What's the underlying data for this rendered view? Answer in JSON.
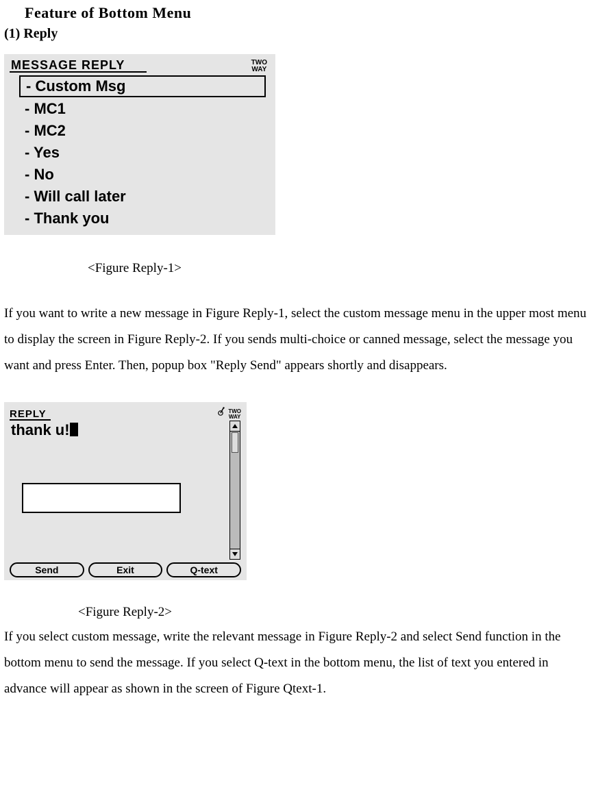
{
  "doc": {
    "title": "Feature of Bottom Menu",
    "subhead": "(1) Reply"
  },
  "figure1": {
    "header": "MESSAGE REPLY",
    "twoway_top": "TWO",
    "twoway_bot": "WAY",
    "items": [
      "- Custom Msg",
      "- MC1",
      "- MC2",
      "- Yes",
      "- No",
      "- Will call later",
      "- Thank you"
    ],
    "caption": "<Figure Reply-1>"
  },
  "para1": "If you want to write a new message in Figure Reply-1, select the custom message menu in the upper most menu to display the screen in Figure Reply-2. If you sends multi-choice or canned message, select the message you want and press Enter. Then, popup box \"Reply Send\" appears shortly and disappears.",
  "figure2": {
    "header": "REPLY",
    "twoway_top": "TWO",
    "twoway_bot": "WAY",
    "typed": "thank u!",
    "buttons": {
      "send": "Send",
      "exit": "Exit",
      "qtext": "Q-text"
    },
    "caption": "<Figure Reply-2>"
  },
  "para2": "If you select custom message, write the relevant message in Figure Reply-2 and select Send function in the bottom menu to send the message. If you select Q-text in the bottom menu, the list of text you entered in advance will appear as shown in the screen of Figure Qtext-1."
}
